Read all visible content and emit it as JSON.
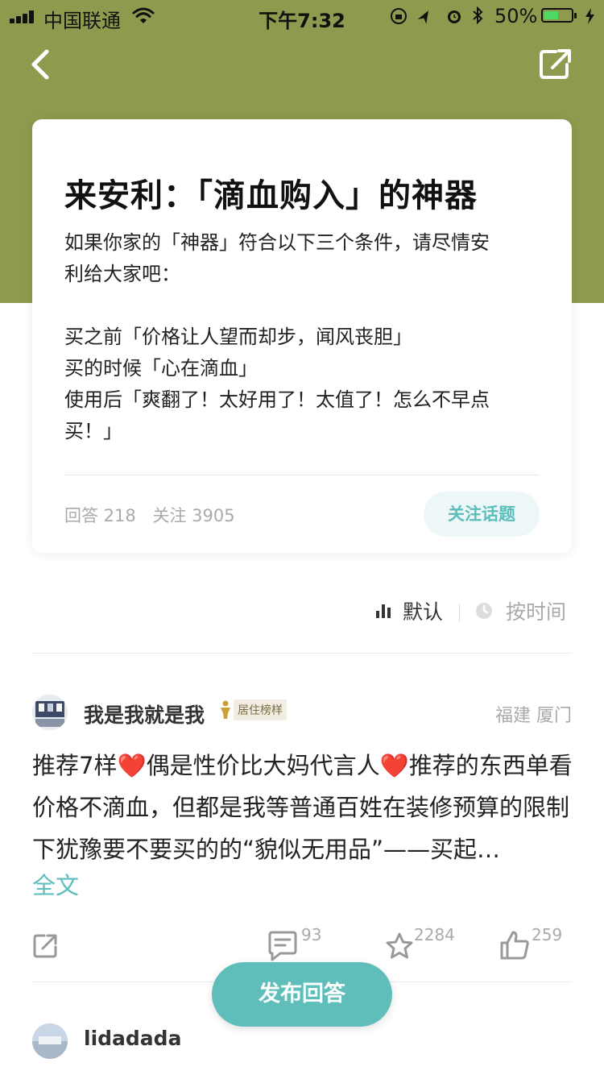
{
  "status_bar": {
    "carrier": "中国联通",
    "time": "下午7:32",
    "battery": "50%"
  },
  "topic": {
    "title": "来安利：「滴血购入」的神器",
    "description": "如果你家的「神器」符合以下三个条件，请尽情安\n利给大家吧：\n\n买之前「价格让人望而却步，闻风丧胆」\n买的时候「心在滴血」\n使用后「爽翻了！太好用了！太值了！怎么不早点\n买！」",
    "answers": "回答 218",
    "followers": "关注 3905",
    "follow_button": "关注话题"
  },
  "sort": {
    "default_label": "默认",
    "time_label": "按时间"
  },
  "answers": [
    {
      "author": "我是我就是我",
      "badge": "居住榜样",
      "location": "福建  厦门",
      "text_part1": "推荐7样",
      "text_part2": "偶是性价比大妈代言人",
      "text_part3": "推荐的东西单看价格不滴血，但都是我等普通百姓在装修预算的限制下犹豫要不要买的的“貌似无用品”——买起…",
      "heart_symbol": "❤️",
      "full_text_link": "全文",
      "comment_count": "93",
      "favorite_count": "2284",
      "like_count": "259"
    },
    {
      "author": "lidadada"
    }
  ],
  "publish_button": "发布回答",
  "colors": {
    "header_bg": "#8e9a4d",
    "accent": "#5bbdbc",
    "heart": "#e0202e"
  },
  "icons": [
    "back-icon",
    "share-icon",
    "bar-chart-icon",
    "clock-icon",
    "comment-icon",
    "star-icon",
    "thumbs-up-icon",
    "trophy-icon"
  ]
}
